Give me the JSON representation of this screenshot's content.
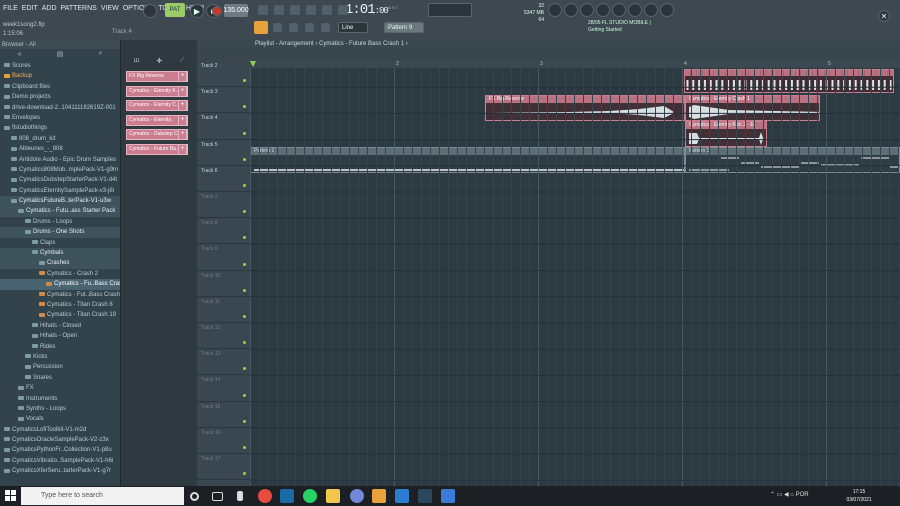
{
  "menu": [
    "FILE",
    "EDIT",
    "ADD",
    "PATTERNS",
    "VIEW",
    "OPTIONS",
    "TOOLS",
    "HELP"
  ],
  "song": {
    "file": "week1song2.flp",
    "elapsed": "1:15:06",
    "track_mini": "Track 4"
  },
  "transport": {
    "pat_label": "PAT",
    "tempo": "135.000",
    "time": "1:01",
    "time_small": ":00",
    "time_label": "B:S:T"
  },
  "cpu": {
    "voices": "32",
    "mem": "5347 MB",
    "cpu": "64"
  },
  "tools": {
    "snap": "Line",
    "pattern": "Pattern 9"
  },
  "hint": {
    "line1": "28/05  FL STUDIO MOBILE |",
    "line2": "Getting Started"
  },
  "browser": {
    "title": "Browser - All",
    "items": [
      {
        "t": "Scores",
        "l": 0,
        "c": "b"
      },
      {
        "t": "Backup",
        "l": 0,
        "c": "o"
      },
      {
        "t": "Clipboard files",
        "l": 0,
        "c": "b"
      },
      {
        "t": "Demo projects",
        "l": 0,
        "c": "b"
      },
      {
        "t": "drive-download-2..104111182619Z-001",
        "l": 0,
        "c": "b"
      },
      {
        "t": "Envelopes",
        "l": 0,
        "c": "b"
      },
      {
        "t": "flstudiothings",
        "l": 0,
        "c": "b"
      },
      {
        "t": "808_drum_kit",
        "l": 1,
        "c": "b"
      },
      {
        "t": "Ableunes_-_808",
        "l": 1,
        "c": "b"
      },
      {
        "t": "Antidote Audio - Epic Drum Samples",
        "l": 1,
        "c": "b"
      },
      {
        "t": "Cymatics808Mob..mplePack-V1-g9m",
        "l": 1,
        "c": "b"
      },
      {
        "t": "CymaticsDubstepStarterPack-V1-d4t",
        "l": 1,
        "c": "b"
      },
      {
        "t": "CymaticsEternitySamplePack-v3-j8i",
        "l": 1,
        "c": "b"
      },
      {
        "t": "CymaticsFutureB..terPack-V1-u3w",
        "l": 1,
        "c": "b",
        "h": 1
      },
      {
        "t": "Cymatics - Futu..ass Starter Pack",
        "l": 2,
        "c": "b",
        "h": 1
      },
      {
        "t": "Drums - Loops",
        "l": 3,
        "c": "b"
      },
      {
        "t": "Drums - One Shots",
        "l": 3,
        "c": "b",
        "h": 1
      },
      {
        "t": "Claps",
        "l": 4,
        "c": "b"
      },
      {
        "t": "Cymbals",
        "l": 4,
        "c": "b",
        "h": 1
      },
      {
        "t": "Crashes",
        "l": 5,
        "c": "b",
        "h": 1
      },
      {
        "t": "Cymatics - Crash 2",
        "l": 5,
        "c": "f"
      },
      {
        "t": "Cymatics - Fu..Bass Crash 1",
        "l": 6,
        "c": "f",
        "s": 1
      },
      {
        "t": "Cymatics - Fut..Bass Crash 2",
        "l": 5,
        "c": "f"
      },
      {
        "t": "Cymatics - Titan Crash 8",
        "l": 5,
        "c": "f"
      },
      {
        "t": "Cymatics - Titan Crash 19",
        "l": 5,
        "c": "f"
      },
      {
        "t": "Hihats - Closed",
        "l": 4,
        "c": "b"
      },
      {
        "t": "Hihats - Open",
        "l": 4,
        "c": "b"
      },
      {
        "t": "Rides",
        "l": 4,
        "c": "b"
      },
      {
        "t": "Kicks",
        "l": 3,
        "c": "b"
      },
      {
        "t": "Percussion",
        "l": 3,
        "c": "b"
      },
      {
        "t": "Snares",
        "l": 3,
        "c": "b"
      },
      {
        "t": "FX",
        "l": 2,
        "c": "b"
      },
      {
        "t": "Instruments",
        "l": 2,
        "c": "b"
      },
      {
        "t": "Synths - Loops",
        "l": 2,
        "c": "b"
      },
      {
        "t": "Vocals",
        "l": 2,
        "c": "b"
      },
      {
        "t": "CymaticsLofiToolkit-V1-m2d",
        "l": 0,
        "c": "b"
      },
      {
        "t": "CymaticsOracleSamplePack-V2-z3x",
        "l": 0,
        "c": "b"
      },
      {
        "t": "CymaticsPythonFr..Collection-V1-p8u",
        "l": 0,
        "c": "b"
      },
      {
        "t": "CymaticsVibratio..SamplePack-V1-h6i",
        "l": 0,
        "c": "b"
      },
      {
        "t": "CymaticsXferSeru..tarterPack-V1-g7r",
        "l": 0,
        "c": "b"
      }
    ]
  },
  "channels": [
    "FX Big Reverse",
    "Cymatics - Eternity K..",
    "Cymatics - Eternity C..",
    "Cymatics - Eternity..",
    "Cymatics - Dubstep C..",
    "Cymatics - Future Ba.."
  ],
  "playlist": {
    "crumb": "Playlist - Arrangement › Cymatics - Future Bass Crash 1 ›",
    "tracks": [
      "Track 2",
      "Track 3",
      "Track 4",
      "Track 5",
      "Track 6",
      "Track 7",
      "Track 8",
      "Track 9",
      "Track 10",
      "Track 11",
      "Track 12",
      "Track 13",
      "Track 14",
      "Track 15",
      "Track 16",
      "Track 17"
    ],
    "ruler": [
      "1",
      "2",
      "3",
      "4",
      "5"
    ],
    "clips": {
      "fx": "FX Big Reverse",
      "crash": "Cymatics - Eternity Crash 1",
      "kick": "Cymatics - Eternity Kick 2 - E",
      "pattern": "Pattern 1"
    }
  },
  "taskbar": {
    "search": "Type here to search",
    "time": "17:15",
    "date": "03/07/2021",
    "lang": "POR"
  }
}
